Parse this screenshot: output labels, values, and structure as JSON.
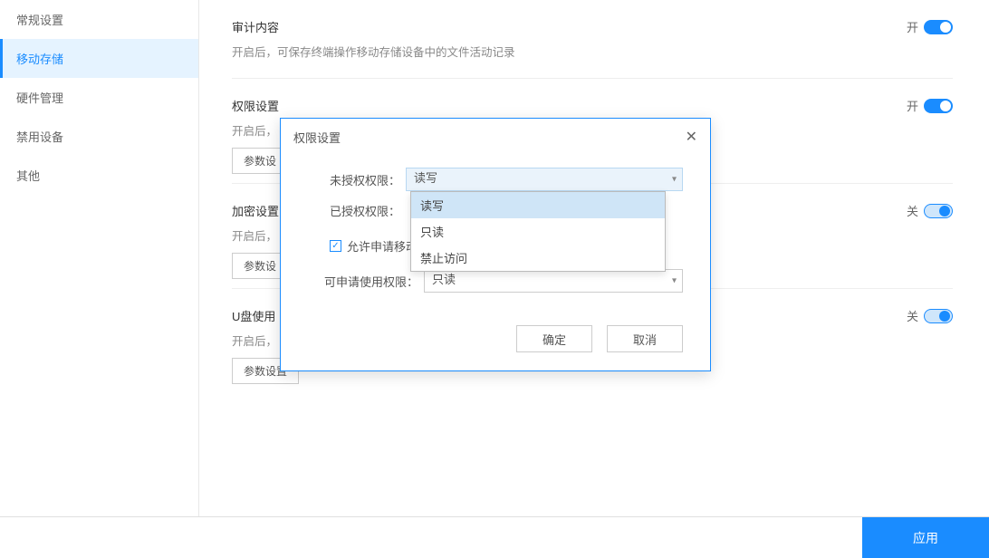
{
  "sidebar": {
    "items": [
      {
        "label": "常规设置"
      },
      {
        "label": "移动存储"
      },
      {
        "label": "硬件管理"
      },
      {
        "label": "禁用设备"
      },
      {
        "label": "其他"
      }
    ]
  },
  "sections": {
    "audit": {
      "title": "审计内容",
      "desc": "开启后，可保存终端操作移动存储设备中的文件活动记录",
      "toggle": "开"
    },
    "perm": {
      "title": "权限设置",
      "desc": "开启后，",
      "toggle": "开",
      "param": "参数设"
    },
    "encrypt": {
      "title": "加密设置",
      "desc": "开启后，",
      "toggle": "关",
      "param": "参数设"
    },
    "udisk": {
      "title": "U盘使用",
      "desc": "开启后，",
      "toggle": "关",
      "param": "参数设置"
    }
  },
  "modal": {
    "title": "权限设置",
    "unauth_label": "未授权权限：",
    "unauth_value": "读写",
    "auth_label": "已授权权限：",
    "checkbox_label": "允许申请移动存储使用审批",
    "apply_perm_label": "可申请使用权限：",
    "apply_perm_value": "只读",
    "ok": "确定",
    "cancel": "取消"
  },
  "dropdown": {
    "options": [
      "读写",
      "只读",
      "禁止访问"
    ]
  },
  "footer": {
    "apply": "应用"
  }
}
